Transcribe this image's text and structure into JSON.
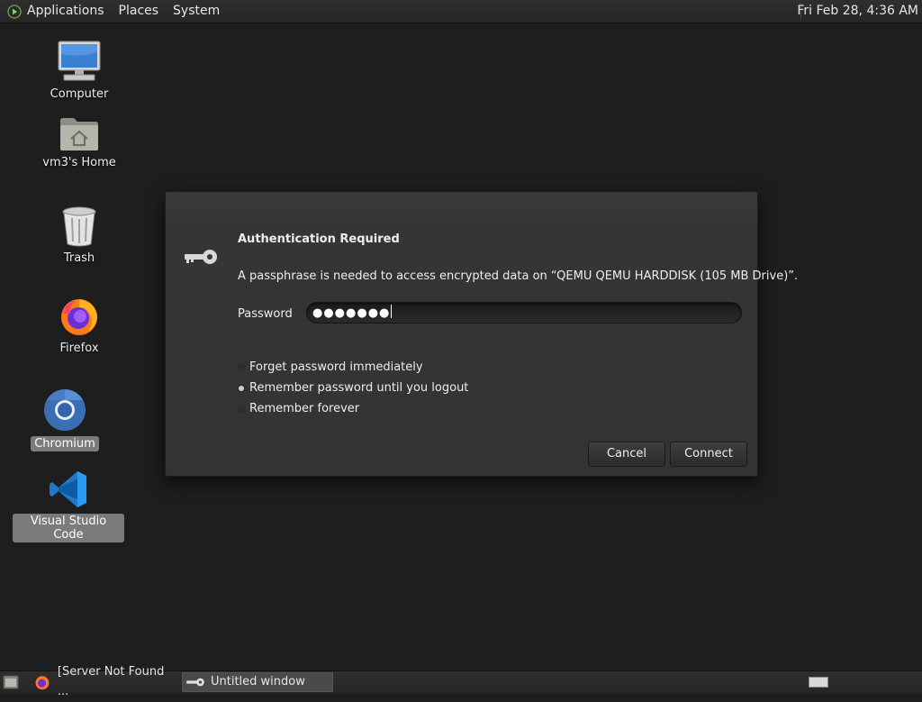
{
  "top_panel": {
    "menus": [
      "Applications",
      "Places",
      "System"
    ],
    "clock": "Fri Feb 28,  4:36 AM"
  },
  "desktop": {
    "icons": [
      {
        "label": "Computer",
        "icon": "computer-icon",
        "selected": false
      },
      {
        "label": "vm3's Home",
        "icon": "home-folder-icon",
        "selected": false
      },
      {
        "label": "Trash",
        "icon": "trash-icon",
        "selected": false
      },
      {
        "label": "Firefox",
        "icon": "firefox-icon",
        "selected": false
      },
      {
        "label": "Chromium",
        "icon": "chromium-icon",
        "selected": true
      },
      {
        "label": "Visual Studio Code",
        "icon": "vscode-icon",
        "selected": true
      }
    ]
  },
  "dialog": {
    "title": "Authentication Required",
    "message": "A passphrase is needed to access encrypted data on “QEMU QEMU HARDDISK (105 MB Drive)”.",
    "password_label": "Password",
    "password_value": "●●●●●●●",
    "options": [
      {
        "label": "Forget password immediately",
        "checked": false
      },
      {
        "label": "Remember password until you logout",
        "checked": true
      },
      {
        "label": "Remember forever",
        "checked": false
      }
    ],
    "cancel_label": "Cancel",
    "connect_label": "Connect"
  },
  "bottom_panel": {
    "tasks": [
      {
        "label": "[Server Not Found ...",
        "icon": "firefox-icon",
        "active": false
      },
      {
        "label": "Untitled window",
        "icon": "key-icon",
        "active": true
      }
    ]
  },
  "colors": {
    "desktop_bg": "#1e1e1e",
    "panel_bg": "#2b2b2b",
    "dialog_bg": "#353535",
    "selection": "#7b7b7b"
  }
}
